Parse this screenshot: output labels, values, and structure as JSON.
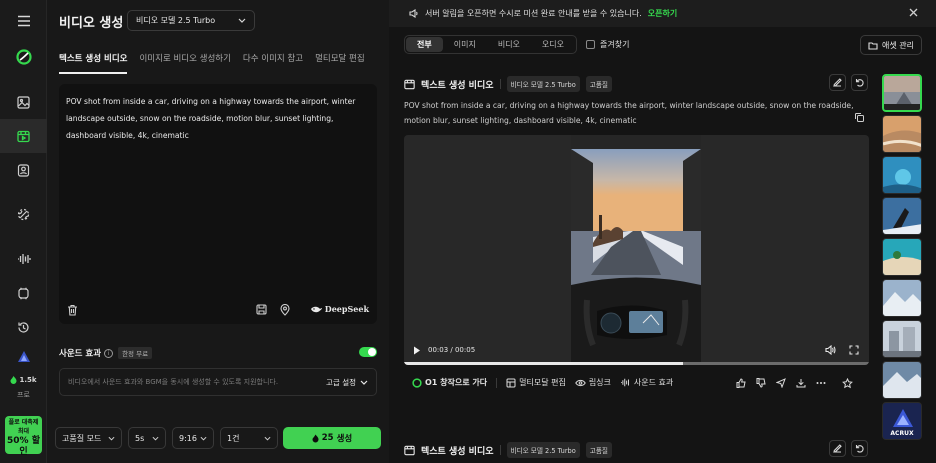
{
  "rail": {
    "credits": "1.5k",
    "plan": "프로",
    "promo": {
      "line1": "플로 대축제",
      "line2": "최대",
      "line3": "50% 할인"
    }
  },
  "left": {
    "title": "비디오 생성",
    "model": "비디오 모델 2.5 Turbo",
    "tabs": [
      "텍스트 생성 비디오",
      "이미지로 비디오 생성하기",
      "다수 이미지 참고",
      "멀티모달 편집"
    ],
    "prompt": "POV shot from inside a car, driving on a highway towards the airport, winter landscape outside, snow on the roadside, motion blur, sunset lighting, dashboard visible, 4k, cinematic",
    "engine": "DeepSeek",
    "sound": {
      "label": "사운드 효과",
      "badge": "한정 무료",
      "enabled": true,
      "placeholder": "비디오에서 사운드 효과와 BGM을 동시에 생성할 수 있도록 지원합니다.",
      "advanced": "고급 설정"
    },
    "options": {
      "quality": "고품질 모드",
      "duration": "5s",
      "ratio": "9:16",
      "count": "1건"
    },
    "generate": {
      "cost": "25",
      "label": "생성"
    }
  },
  "right": {
    "notice": "서버 알림을 오픈하면 수시로 미션 완료 안내를 받을 수 있습니다.",
    "notice_link": "오픈하기",
    "filters": [
      "전부",
      "이미지",
      "비디오",
      "오디오"
    ],
    "favorites": "즐겨찾기",
    "asset_manage": "애셋 관리",
    "card": {
      "title": "텍스트 생성 비디오",
      "model": "비디오 모델 2.5 Turbo",
      "quality": "고품질",
      "prompt": "POV shot from inside a car, driving on a highway towards the airport, winter landscape outside, snow on the roadside, motion blur, sunset lighting, dashboard visible, 4k, cinematic",
      "time": "00:03 / 00:05",
      "progress": 0.6,
      "actions": [
        "O1 창작으로 가다",
        "멀티모달 편집",
        "립싱크",
        "사운드 효과"
      ]
    },
    "card2": {
      "title": "텍스트 생성 비디오",
      "model": "비디오 모델 2.5 Turbo",
      "quality": "고품질"
    },
    "thumb_brand": "ACRUX"
  },
  "colors": {
    "accent": "#41d152",
    "bg": "#141414",
    "panel": "#181818"
  }
}
